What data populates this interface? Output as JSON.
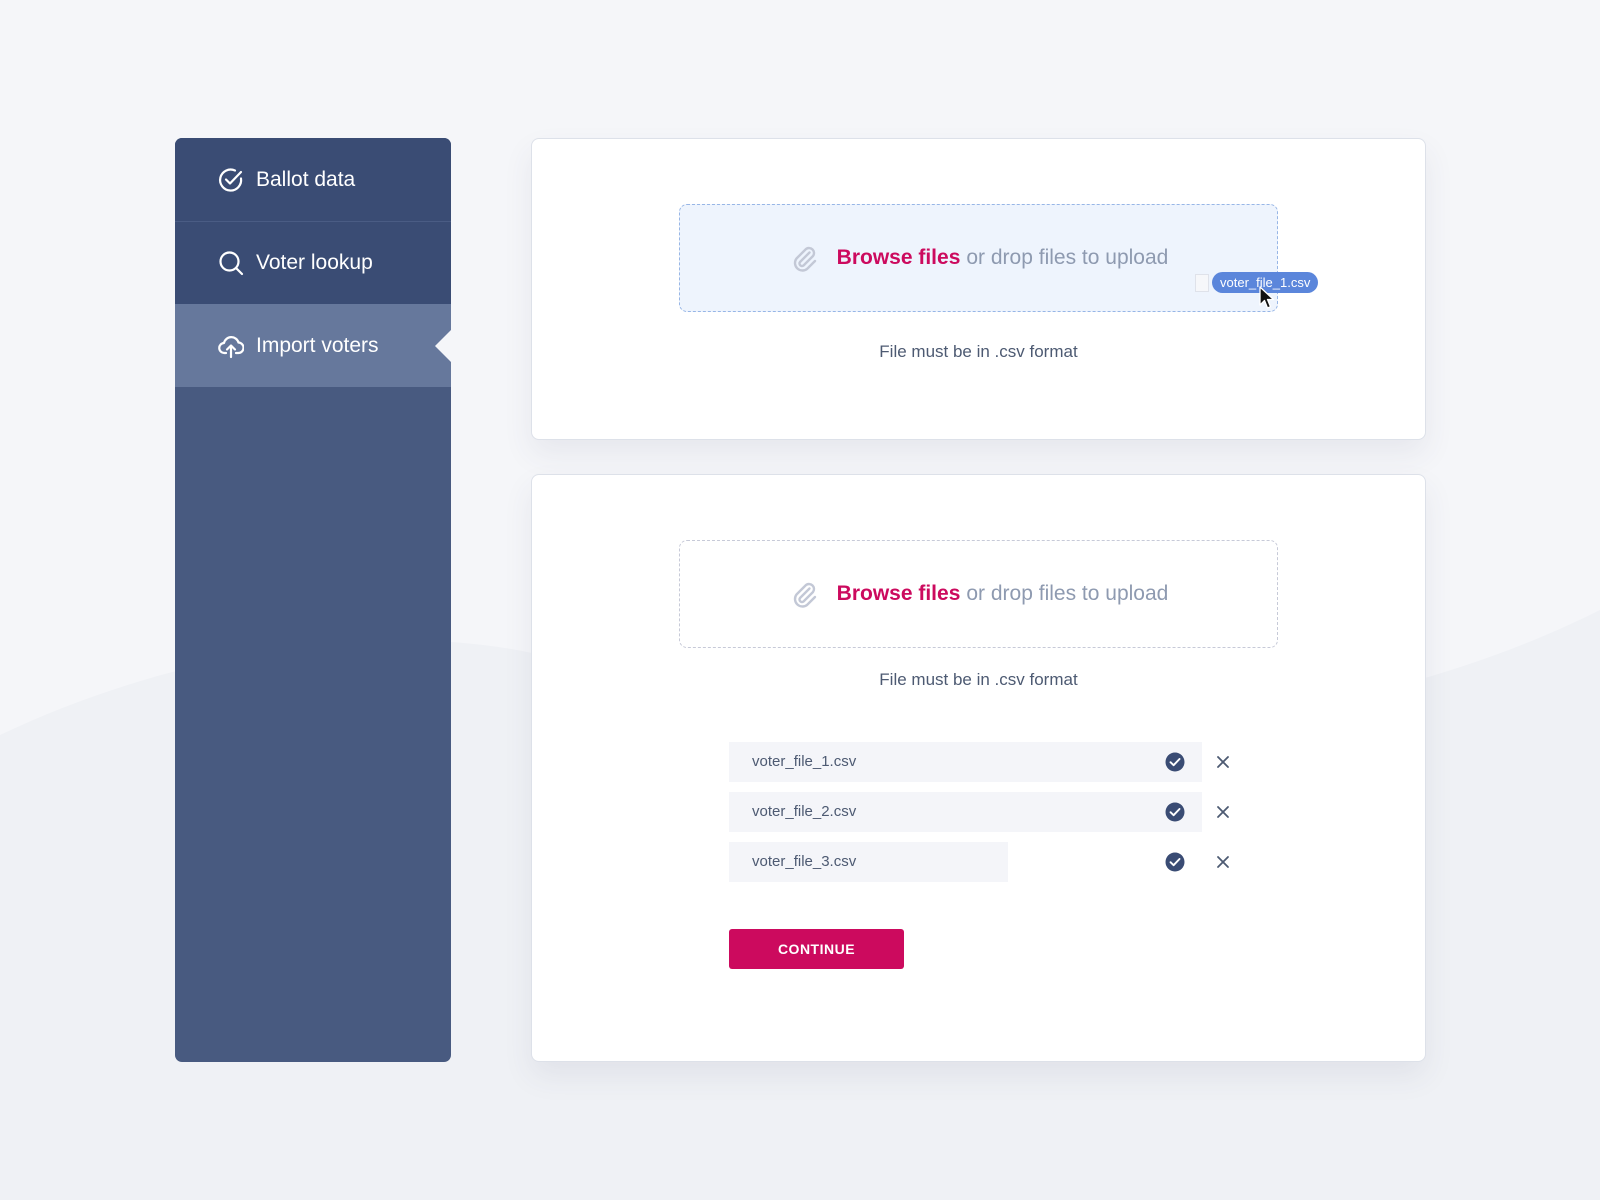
{
  "colors": {
    "sidebar_bg": "#485a80",
    "sidebar_item_bg": "#3a4c74",
    "sidebar_active_bg": "#66789c",
    "accent": "#cc0a5e",
    "drag_chip": "#5b86db",
    "check": "#3a4c74"
  },
  "sidebar": {
    "items": [
      {
        "label": "Ballot data",
        "icon": "check-circle-icon",
        "active": false
      },
      {
        "label": "Voter lookup",
        "icon": "search-icon",
        "active": false
      },
      {
        "label": "Import voters",
        "icon": "cloud-upload-icon",
        "active": true
      }
    ]
  },
  "upload_top": {
    "browse_label": "Browse files",
    "drop_label": "or drop files to upload",
    "hint": "File must be in .csv format",
    "state": "drag-hover",
    "dragged_file": "voter_file_1.csv"
  },
  "upload_bottom": {
    "browse_label": "Browse files",
    "drop_label": "or drop files to upload",
    "hint": "File must be in .csv format",
    "files": [
      {
        "name": "voter_file_1.csv",
        "progress": 1.0,
        "status": "complete"
      },
      {
        "name": "voter_file_2.csv",
        "progress": 1.0,
        "status": "complete"
      },
      {
        "name": "voter_file_3.csv",
        "progress": 0.59,
        "status": "complete"
      }
    ],
    "continue_label": "CONTINUE"
  }
}
